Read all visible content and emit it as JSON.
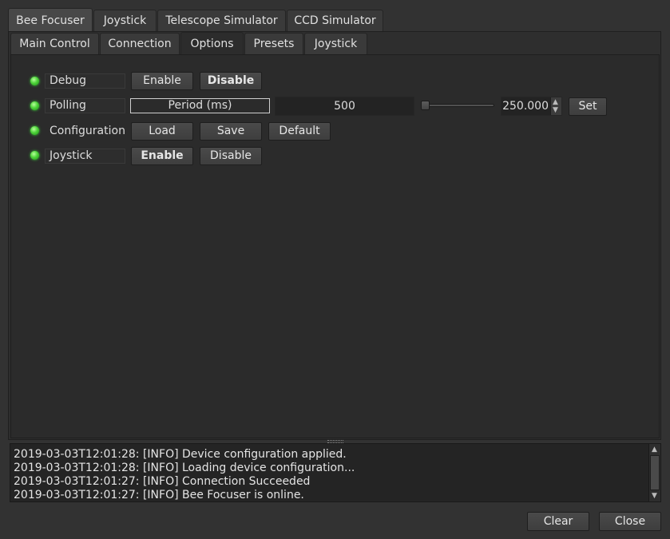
{
  "tabs_top": [
    "Bee Focuser",
    "Joystick",
    "Telescope Simulator",
    "CCD Simulator"
  ],
  "tabs_sub": [
    "Main Control",
    "Connection",
    "Options",
    "Presets",
    "Joystick"
  ],
  "properties": {
    "debug": {
      "label": "Debug",
      "enable": "Enable",
      "disable": "Disable"
    },
    "polling": {
      "label": "Polling",
      "period_label": "Period (ms)",
      "value": "500",
      "spin_value": "250.000",
      "set": "Set",
      "slider_level": 0.0
    },
    "configuration": {
      "label": "Configuration",
      "load": "Load",
      "save": "Save",
      "default": "Default"
    },
    "joystick": {
      "label": "Joystick",
      "enable": "Enable",
      "disable": "Disable"
    }
  },
  "log": {
    "lines": [
      "2019-03-03T12:01:28: [INFO] Device configuration applied.",
      "2019-03-03T12:01:28: [INFO] Loading device configuration...",
      "2019-03-03T12:01:27: [INFO] Connection Succeeded",
      "2019-03-03T12:01:27: [INFO] Bee Focuser is online."
    ]
  },
  "footer": {
    "clear": "Clear",
    "close": "Close"
  },
  "colors": {
    "led_ok": "#4ed33a",
    "background": "#323232",
    "panel": "#2b2b2b"
  }
}
